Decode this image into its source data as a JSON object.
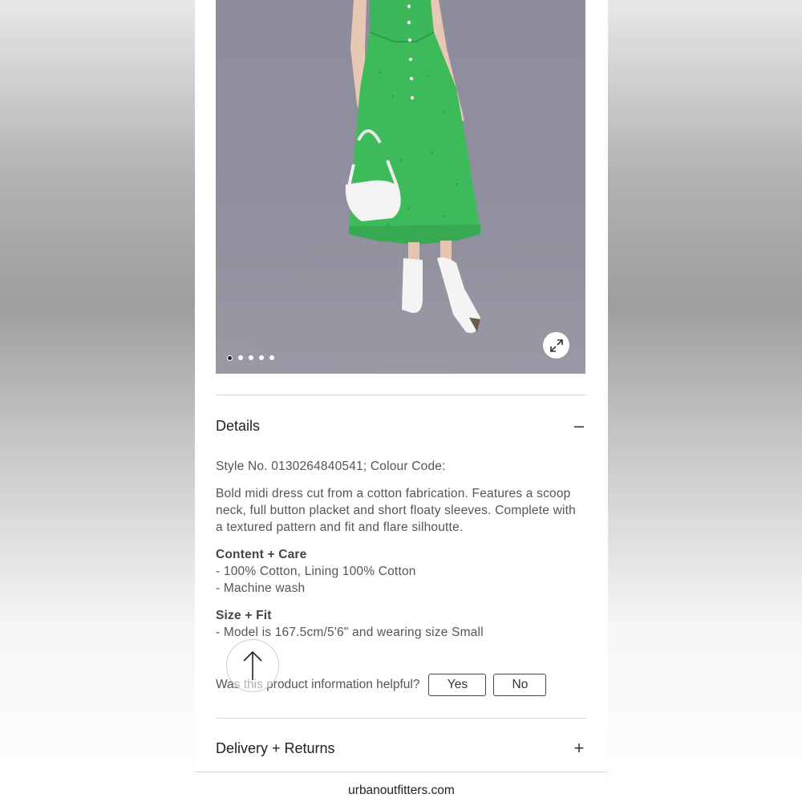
{
  "product_image": {
    "alt_icon": "product-photo-green-midi-dress",
    "carousel": {
      "total": 5,
      "active": 1
    },
    "expand_icon": "expand-arrows-icon"
  },
  "details": {
    "title": "Details",
    "toggle_icon": "minus-icon",
    "style_line": "Style No. 0130264840541; Colour Code:",
    "description": "Bold midi dress cut from a cotton fabrication. Features a scoop neck, full button placket and short floaty sleeves. Complete with a textured pattern and fit and flare silhoutte.",
    "content_care": {
      "heading": "Content + Care",
      "items": [
        "- 100% Cotton, Lining 100% Cotton",
        "- Machine wash"
      ]
    },
    "size_fit": {
      "heading": "Size + Fit",
      "items": [
        "- Model is 167.5cm/5'6\" and wearing size Small"
      ]
    },
    "helpful": {
      "question": "Was this product information helpful?",
      "yes": "Yes",
      "no": "No"
    }
  },
  "back_to_top_icon": "arrow-up-icon",
  "delivery": {
    "title": "Delivery + Returns",
    "toggle_icon": "plus-icon"
  },
  "footer": {
    "url": "urbanoutfitters.com"
  },
  "colors": {
    "dress_green": "#3dbb5a",
    "backdrop": "#8e8d9c"
  }
}
